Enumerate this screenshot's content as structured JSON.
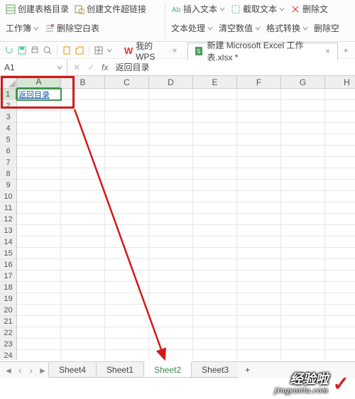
{
  "ribbon": {
    "group1": {
      "createTableToc": "创建表格目录",
      "workbook": "工作簿",
      "deleteBlankRows": "删除空白表",
      "createFileHyperlink": "创建文件超链接"
    },
    "group2": {
      "insertText": "插入文本",
      "textProcessing": "文本处理",
      "captureText": "截取文本",
      "clearValues": "清空数值",
      "deleteText": "删除文",
      "formatConvert": "格式转换",
      "deleteBlank": "删除空"
    }
  },
  "tabs": {
    "myWps": "我的WPS",
    "file2": "新建 Microsoft Excel 工作表.xlsx *"
  },
  "formula": {
    "nameBox": "A1",
    "fx": "fx",
    "value": "返回目录"
  },
  "columns": [
    "A",
    "B",
    "C",
    "D",
    "E",
    "F",
    "G",
    "H"
  ],
  "rowCount": 24,
  "cellA1": "返回目录",
  "sheets": {
    "s1": "Sheet4",
    "s2": "Sheet1",
    "s3": "Sheet2",
    "s4": "Sheet3",
    "add": "+"
  },
  "watermark": {
    "line1": "经验啦",
    "line2": "jingyanla.com",
    "check": "✓"
  }
}
